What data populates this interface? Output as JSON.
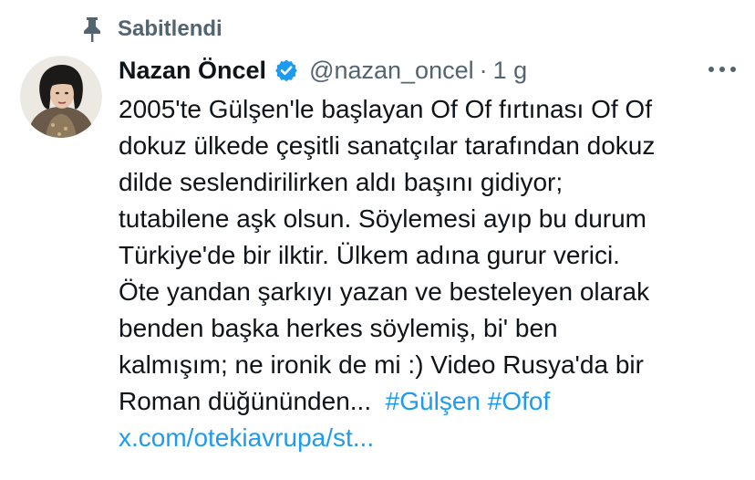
{
  "pinned": {
    "icon": "pin-icon",
    "label": "Sabitlendi"
  },
  "tweet": {
    "avatar_icon": "avatar",
    "display_name": "Nazan Öncel",
    "verified_icon": "verified-badge-icon",
    "verified_color": "#1d9bf0",
    "handle": "@nazan_oncel",
    "separator": "·",
    "time": "1 g",
    "more_icon": "more-dots-icon",
    "text_lines": [
      "2005'te Gülşen'le başlayan Of Of fırtınası Of Of",
      "dokuz ülkede çeşitli sanatçılar tarafından dokuz",
      "dilde seslendirilirken aldı başını gidiyor;",
      "tutabilene aşk olsun.  Söylemesi ayıp bu durum",
      "Türkiye'de bir ilktir. Ülkem adına gurur verici.",
      "Öte yandan şarkıyı yazan ve besteleyen olarak",
      "benden başka herkes söylemiş, bi' ben",
      "kalmışım; ne ironik de mi :)  Video Rusya'da bir"
    ],
    "last_line_text": "Roman düğününden...",
    "hashtags": [
      "#Gülşen",
      "#Ofof"
    ],
    "url": "x.com/otekiavrupa/st..."
  },
  "colors": {
    "text": "#0f1419",
    "secondary": "#536471",
    "link": "#1d9bf0"
  }
}
